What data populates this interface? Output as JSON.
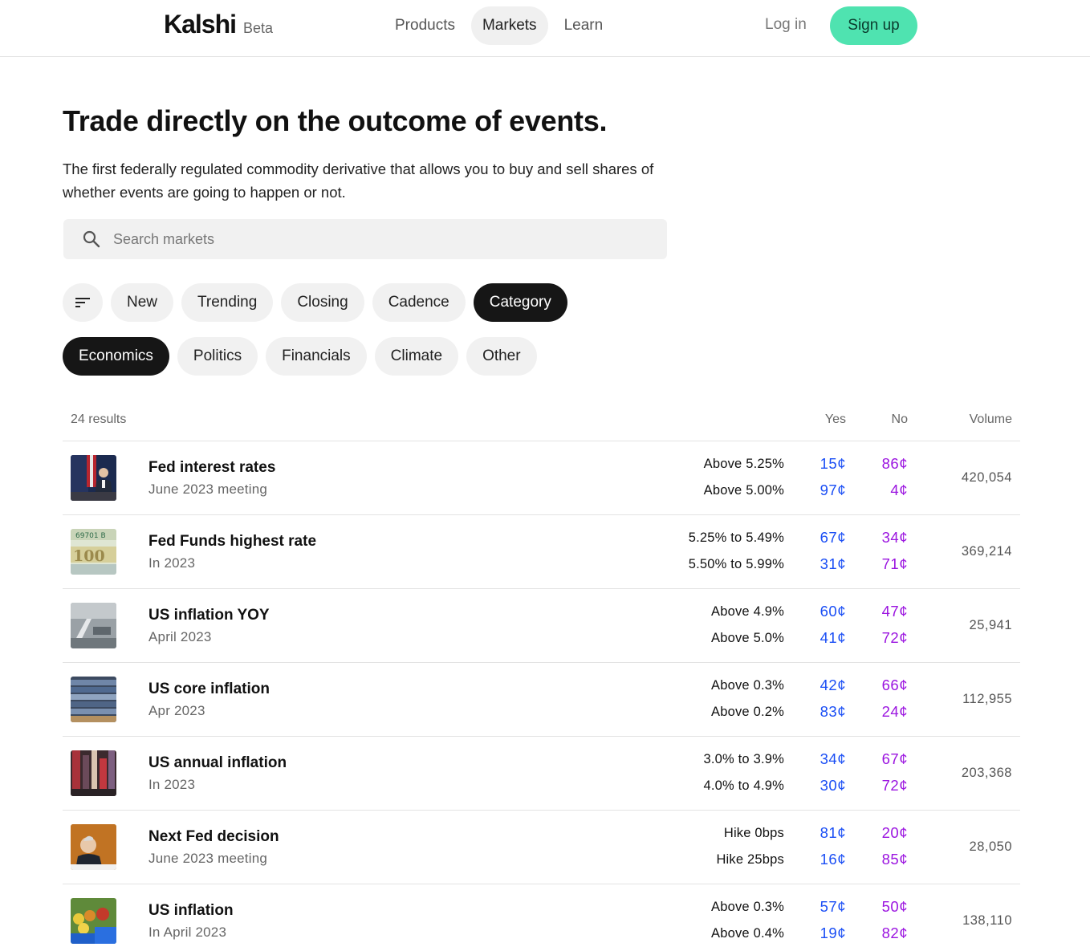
{
  "header": {
    "logo": "Kalshi",
    "badge": "Beta",
    "nav": [
      "Products",
      "Markets",
      "Learn"
    ],
    "login": "Log in",
    "signup": "Sign up"
  },
  "hero": {
    "title": "Trade directly on the outcome of events.",
    "description": "The first federally regulated commodity derivative that allows you to buy and sell shares of whether events are going to happen or not."
  },
  "search": {
    "placeholder": "Search markets",
    "value": ""
  },
  "filters": [
    "New",
    "Trending",
    "Closing",
    "Cadence",
    "Category"
  ],
  "categories": [
    "Economics",
    "Politics",
    "Financials",
    "Climate",
    "Other"
  ],
  "table": {
    "results": "24 results",
    "col_yes": "Yes",
    "col_no": "No",
    "col_volume": "Volume",
    "rows": [
      {
        "title": "Fed interest rates",
        "subtitle": "June 2023 meeting",
        "out1": "Above 5.25%",
        "yes1": "15¢",
        "no1": "86¢",
        "out2": "Above 5.00%",
        "yes2": "97¢",
        "no2": "4¢",
        "volume": "420,054"
      },
      {
        "title": "Fed Funds highest rate",
        "subtitle": "In 2023",
        "out1": "5.25% to 5.49%",
        "yes1": "67¢",
        "no1": "34¢",
        "out2": "5.50% to 5.99%",
        "yes2": "31¢",
        "no2": "71¢",
        "volume": "369,214"
      },
      {
        "title": "US inflation YOY",
        "subtitle": "April 2023",
        "out1": "Above 4.9%",
        "yes1": "60¢",
        "no1": "47¢",
        "out2": "Above 5.0%",
        "yes2": "41¢",
        "no2": "72¢",
        "volume": "25,941"
      },
      {
        "title": "US core inflation",
        "subtitle": "Apr 2023",
        "out1": "Above 0.3%",
        "yes1": "42¢",
        "no1": "66¢",
        "out2": "Above 0.2%",
        "yes2": "83¢",
        "no2": "24¢",
        "volume": "112,955"
      },
      {
        "title": "US annual inflation",
        "subtitle": "In 2023",
        "out1": "3.0% to 3.9%",
        "yes1": "34¢",
        "no1": "67¢",
        "out2": "4.0% to 4.9%",
        "yes2": "30¢",
        "no2": "72¢",
        "volume": "203,368"
      },
      {
        "title": "Next Fed decision",
        "subtitle": "June 2023 meeting",
        "out1": "Hike 0bps",
        "yes1": "81¢",
        "no1": "20¢",
        "out2": "Hike 25bps",
        "yes2": "16¢",
        "no2": "85¢",
        "volume": "28,050"
      },
      {
        "title": "US inflation",
        "subtitle": "In April 2023",
        "out1": "Above 0.3%",
        "yes1": "57¢",
        "no1": "50¢",
        "out2": "Above 0.4%",
        "yes2": "19¢",
        "no2": "82¢",
        "volume": "138,110"
      }
    ]
  },
  "colors": {
    "signup": "#4fe3b0",
    "yes": "#1a4ef5",
    "no": "#9b14e0",
    "chip_active": "#161616"
  }
}
